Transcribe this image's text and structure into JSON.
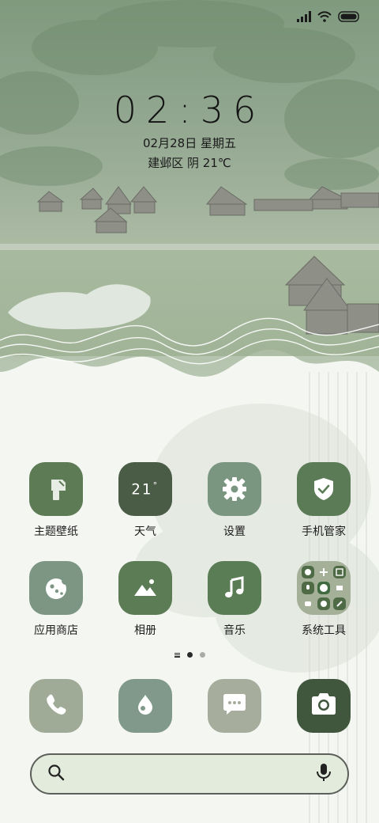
{
  "lock_info": {
    "time": "02:36",
    "date": "02月28日 星期五",
    "weather": "建邺区 阴 21℃"
  },
  "status_bar": {
    "icons": [
      "signal-icon",
      "wifi-icon",
      "battery-icon"
    ]
  },
  "apps": [
    {
      "name": "theme-wallpaper",
      "label": "主题壁纸",
      "icon": "brush-icon",
      "color": "#5d7b55"
    },
    {
      "name": "weather",
      "label": "天气",
      "icon": "weather-temp",
      "temp": "21",
      "degree": "°",
      "color": "#4a5b46"
    },
    {
      "name": "settings",
      "label": "设置",
      "icon": "gear-icon",
      "color": "#7a9680"
    },
    {
      "name": "phone-manager",
      "label": "手机管家",
      "icon": "shield-check-icon",
      "color": "#5a7b55"
    },
    {
      "name": "app-store",
      "label": "应用商店",
      "icon": "app-store-icon",
      "color": "#7d9684"
    },
    {
      "name": "gallery",
      "label": "相册",
      "icon": "mountain-icon",
      "color": "#5c7c55"
    },
    {
      "name": "music",
      "label": "音乐",
      "icon": "music-note-icon",
      "color": "#5a7d55"
    },
    {
      "name": "system-tools",
      "label": "系统工具",
      "icon": "folder-icon",
      "color": "#a5b099"
    }
  ],
  "dock": [
    {
      "name": "phone",
      "icon": "phone-icon",
      "color": "#9fab97"
    },
    {
      "name": "browser",
      "icon": "drop-icon",
      "color": "#80998a"
    },
    {
      "name": "messages",
      "icon": "message-icon",
      "color": "#a6ad9c"
    },
    {
      "name": "camera",
      "icon": "camera-icon",
      "color": "#40573d"
    }
  ],
  "pager": {
    "pages": 2,
    "active": 0
  },
  "search_bar": {
    "icons": [
      "search-icon",
      "microphone-icon"
    ]
  },
  "colors": {
    "dark_green": "#4a5b46",
    "accent_green": "#5d7b55",
    "sage": "#7d9684",
    "search_bg": "#e2ebdc"
  }
}
